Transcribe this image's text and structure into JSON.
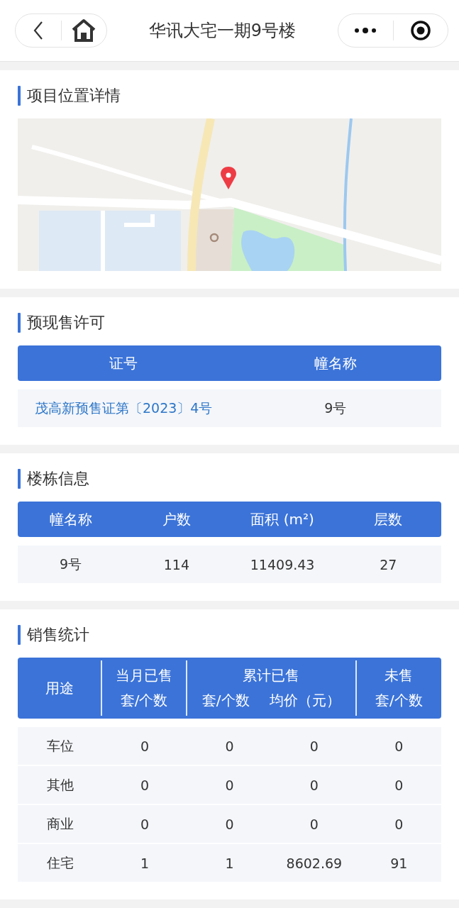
{
  "nav": {
    "title": "华讯大宅一期9号楼"
  },
  "location": {
    "title": "项目位置详情"
  },
  "presale": {
    "title": "预现售许可",
    "columns": [
      "证号",
      "幢名称"
    ],
    "rows": [
      {
        "kind": "link",
        "cells": [
          "茂高新预售证第〔2023〕4号",
          "9号"
        ]
      }
    ]
  },
  "building": {
    "title": "楼栋信息",
    "columns": [
      "幢名称",
      "户数",
      "面积 (m²)",
      "层数"
    ],
    "rows": [
      {
        "kind": "plain",
        "cells": [
          "9号",
          "114",
          "11409.43",
          "27"
        ]
      }
    ]
  },
  "sales": {
    "title": "销售统计",
    "columns": [
      {
        "label": "用途"
      },
      {
        "group": "当月已售",
        "label": "套/个数"
      },
      {
        "group": "累计已售",
        "label": "套/个数"
      },
      {
        "label": "均价（元）"
      },
      {
        "group": "未售",
        "label": "套/个数"
      }
    ],
    "rows": [
      {
        "kind": "plain",
        "cells": [
          "车位",
          "0",
          "0",
          "0",
          "0"
        ]
      },
      {
        "kind": "plain",
        "cells": [
          "其他",
          "0",
          "0",
          "0",
          "0"
        ]
      },
      {
        "kind": "plain",
        "cells": [
          "商业",
          "0",
          "0",
          "0",
          "0"
        ]
      },
      {
        "kind": "plain",
        "cells": [
          "住宅",
          "1",
          "1",
          "8602.69",
          "91"
        ]
      }
    ]
  }
}
